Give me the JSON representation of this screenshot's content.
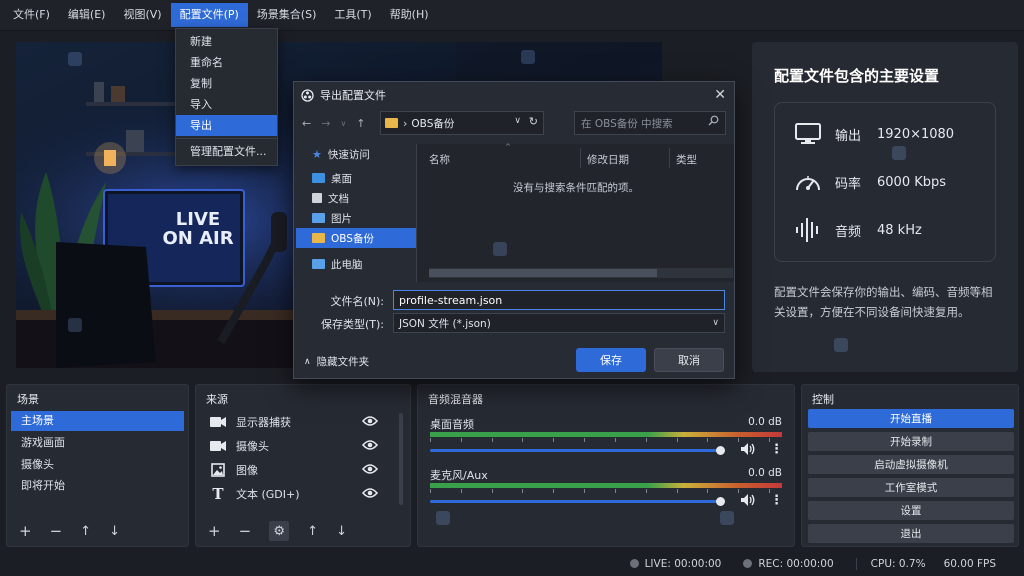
{
  "menubar": {
    "items": [
      "文件(F)",
      "编辑(E)",
      "视图(V)",
      "配置文件(P)",
      "场景集合(S)",
      "工具(T)",
      "帮助(H)"
    ]
  },
  "profile_menu": {
    "items": [
      "新建",
      "重命名",
      "复制",
      "导入",
      "导出",
      "管理配置文件..."
    ]
  },
  "preview": {
    "sign_line1": "LIVE",
    "sign_line2": "ON AIR"
  },
  "info_panel": {
    "title": "配置文件包含的主要设置",
    "rows": [
      {
        "label": "输出",
        "value": "1920×1080",
        "icon": "monitor-icon"
      },
      {
        "label": "码率",
        "value": "6000 Kbps",
        "icon": "speedometer-icon"
      },
      {
        "label": "音频",
        "value": "48 kHz",
        "icon": "audio-wave-icon"
      }
    ],
    "description": "配置文件会保存你的输出、编码、音频等相关设置，方便在不同设备间快速复用。"
  },
  "dialog": {
    "title": "导出配置文件",
    "path": "OBS备份",
    "path_sep": "›",
    "search_placeholder": "在 OBS备份 中搜索",
    "sidebar": [
      "快速访问",
      "桌面",
      "文档",
      "图片",
      "OBS备份",
      "此电脑"
    ],
    "columns": [
      "名称",
      "修改日期",
      "类型"
    ],
    "empty_message": "没有与搜索条件匹配的项。",
    "filename_label": "文件名(N):",
    "filename_value": "profile-stream.json",
    "filetype_label": "保存类型(T):",
    "filetype_value": "JSON 文件 (*.json)",
    "hide_folders": "隐藏文件夹",
    "save": "保存",
    "cancel": "取消",
    "close": "✕"
  },
  "scenes": {
    "title": "场景",
    "items": [
      "主场景",
      "游戏画面",
      "摄像头",
      "即将开始"
    ]
  },
  "sources": {
    "title": "来源",
    "items": [
      {
        "label": "显示器捕获",
        "icon": "camera-icon"
      },
      {
        "label": "摄像头",
        "icon": "camera-icon"
      },
      {
        "label": "图像",
        "icon": "image-icon"
      },
      {
        "label": "文本 (GDI+)",
        "icon": "text-icon"
      }
    ]
  },
  "mixer": {
    "title": "音频混音器",
    "channels": [
      {
        "name": "桌面音频",
        "db": "0.0 dB",
        "level": 0.98
      },
      {
        "name": "麦克风/Aux",
        "db": "0.0 dB",
        "level": 0.98
      }
    ]
  },
  "controls": {
    "title": "控制",
    "buttons": [
      "开始直播",
      "开始录制",
      "启动虚拟摄像机",
      "工作室模式",
      "设置",
      "退出"
    ]
  },
  "status": {
    "live": "LIVE: 00:00:00",
    "rec": "REC: 00:00:00",
    "cpu": "CPU: 0.7%",
    "fps": "60.00 FPS"
  },
  "colors": {
    "accent": "#2f6bd8",
    "background": "#1b1e24",
    "panel": "#262a32"
  }
}
